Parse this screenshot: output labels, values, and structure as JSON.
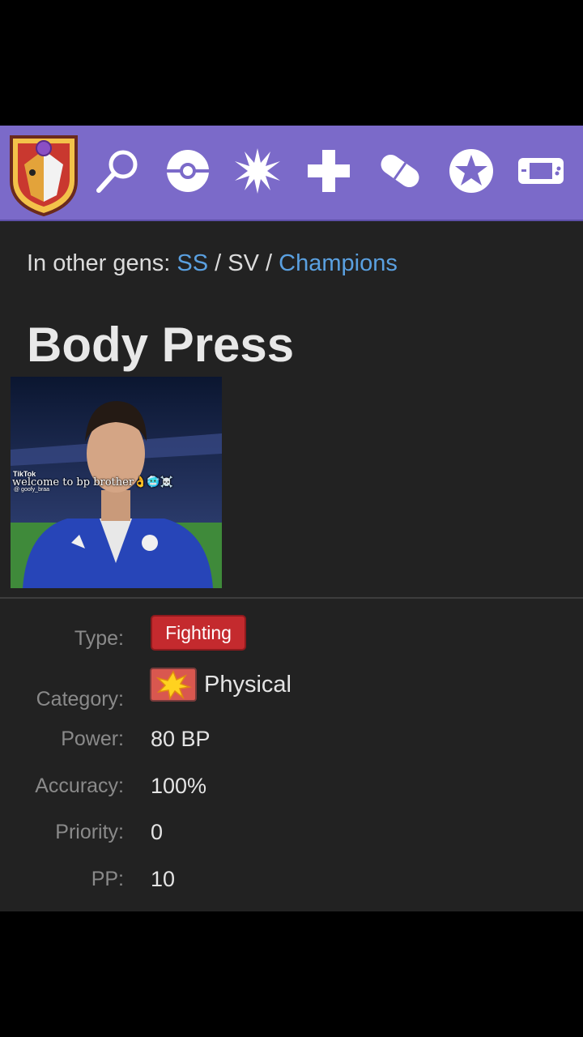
{
  "nav": {
    "icons": [
      "site-logo",
      "search-icon",
      "pokeball-icon",
      "spark-icon",
      "plus-icon",
      "capsule-icon",
      "star-icon",
      "gameboy-icon"
    ]
  },
  "gens": {
    "prefix": "In other gens:",
    "links": [
      "SS",
      "SV",
      "Champions"
    ],
    "separator": "/"
  },
  "move": {
    "name": "Body Press"
  },
  "media": {
    "caption": "welcome to bp brother👌🥶☠️",
    "watermark": "TikTok",
    "handle": "@ goofy_braa"
  },
  "details": {
    "type_label": "Type:",
    "type_value": "Fighting",
    "category_label": "Category:",
    "category_value": "Physical",
    "power_label": "Power:",
    "power_value": "80 BP",
    "accuracy_label": "Accuracy:",
    "accuracy_value": "100%",
    "priority_label": "Priority:",
    "priority_value": "0",
    "pp_label": "PP:",
    "pp_value": "10"
  },
  "colors": {
    "topbar": "#7b6ac9",
    "link": "#5aa0e0",
    "fighting": "#c42a2e",
    "background": "#222222"
  }
}
